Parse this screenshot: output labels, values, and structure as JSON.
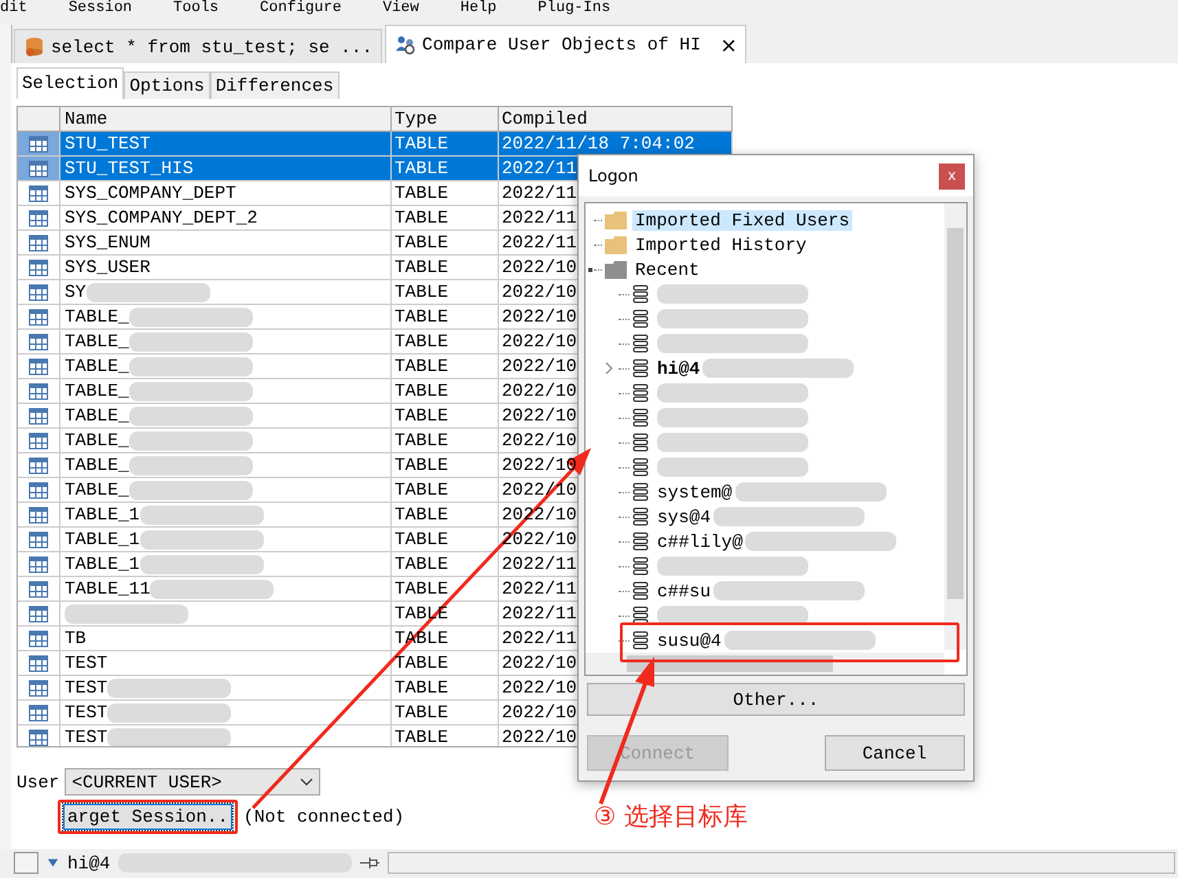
{
  "menu": [
    "dit",
    "Session",
    "Tools",
    "Configure",
    "View",
    "Help",
    "Plug-Ins"
  ],
  "tabs": [
    {
      "label": "select * from stu_test; se ...",
      "selected": false,
      "kind": "sql"
    },
    {
      "label": "Compare User Objects of HI",
      "selected": true,
      "kind": "compare",
      "close": "×"
    }
  ],
  "subtabs": [
    {
      "label": "Selection",
      "selected": true
    },
    {
      "label": "Options",
      "selected": false
    },
    {
      "label": "Differences",
      "selected": false
    }
  ],
  "table": {
    "columns": [
      "Name",
      "Type",
      "Compiled"
    ],
    "rows": [
      {
        "name": "STU_TEST",
        "type": "TABLE",
        "compiled": "2022/11/18 7:04:02",
        "selected": true,
        "blurred": false
      },
      {
        "name": "STU_TEST_HIS",
        "type": "TABLE",
        "compiled": "2022/11",
        "selected": true,
        "blurred": false
      },
      {
        "name": "SYS_COMPANY_DEPT",
        "type": "TABLE",
        "compiled": "2022/11",
        "selected": false,
        "blurred": false
      },
      {
        "name": "SYS_COMPANY_DEPT_2",
        "type": "TABLE",
        "compiled": "2022/11",
        "selected": false,
        "blurred": false
      },
      {
        "name": "SYS_ENUM",
        "type": "TABLE",
        "compiled": "2022/11",
        "selected": false,
        "blurred": false
      },
      {
        "name": "SYS_USER",
        "type": "TABLE",
        "compiled": "2022/10",
        "selected": false,
        "blurred": false
      },
      {
        "name": "SY",
        "type": "TABLE",
        "compiled": "2022/10",
        "selected": false,
        "blurred": true
      },
      {
        "name": "TABLE_",
        "type": "TABLE",
        "compiled": "2022/10",
        "selected": false,
        "blurred": true
      },
      {
        "name": "TABLE_",
        "type": "TABLE",
        "compiled": "2022/10",
        "selected": false,
        "blurred": true
      },
      {
        "name": "TABLE_",
        "type": "TABLE",
        "compiled": "2022/10",
        "selected": false,
        "blurred": true
      },
      {
        "name": "TABLE_",
        "type": "TABLE",
        "compiled": "2022/10",
        "selected": false,
        "blurred": true
      },
      {
        "name": "TABLE_",
        "type": "TABLE",
        "compiled": "2022/10",
        "selected": false,
        "blurred": true
      },
      {
        "name": "TABLE_",
        "type": "TABLE",
        "compiled": "2022/10",
        "selected": false,
        "blurred": true
      },
      {
        "name": "TABLE_",
        "type": "TABLE",
        "compiled": "2022/10",
        "selected": false,
        "blurred": true
      },
      {
        "name": "TABLE_",
        "type": "TABLE",
        "compiled": "2022/10",
        "selected": false,
        "blurred": true
      },
      {
        "name": "TABLE_1",
        "type": "TABLE",
        "compiled": "2022/10",
        "selected": false,
        "blurred": true
      },
      {
        "name": "TABLE_1",
        "type": "TABLE",
        "compiled": "2022/10",
        "selected": false,
        "blurred": true
      },
      {
        "name": "TABLE_1",
        "type": "TABLE",
        "compiled": "2022/11",
        "selected": false,
        "blurred": true
      },
      {
        "name": "TABLE_11",
        "type": "TABLE",
        "compiled": "2022/11",
        "selected": false,
        "blurred": true
      },
      {
        "type": "TABLE",
        "compiled": "2022/11",
        "selected": false,
        "blurred": true
      },
      {
        "name": "TB",
        "type": "TABLE",
        "compiled": "2022/11",
        "selected": false,
        "blurred": false
      },
      {
        "name": "TEST",
        "type": "TABLE",
        "compiled": "2022/10",
        "selected": false,
        "blurred": false
      },
      {
        "name": "TEST",
        "type": "TABLE",
        "compiled": "2022/10",
        "selected": false,
        "blurred": true
      },
      {
        "name": "TEST",
        "type": "TABLE",
        "compiled": "2022/10",
        "selected": false,
        "blurred": true
      },
      {
        "name": "TEST",
        "type": "TABLE",
        "compiled": "2022/10",
        "selected": false,
        "blurred": true
      }
    ]
  },
  "user": {
    "label": "User",
    "value": "<CURRENT USER>"
  },
  "target_session": {
    "button": "arget Session..",
    "status": "(Not connected)"
  },
  "status_bar": {
    "session": "hi@4"
  },
  "logon": {
    "title": "Logon",
    "close": "x",
    "tree": [
      {
        "label": "Imported Fixed Users",
        "kind": "folder",
        "selected": true,
        "expanded": false
      },
      {
        "label": "Imported History",
        "kind": "folder",
        "selected": false,
        "expanded": false
      },
      {
        "label": "Recent",
        "kind": "group",
        "selected": false,
        "expanded": true,
        "children": [
          {
            "blurred": true,
            "expandable": false
          },
          {
            "blurred": true,
            "expandable": false
          },
          {
            "blurred": true,
            "expandable": false
          },
          {
            "label": "hi@4",
            "blurred": true,
            "bold": true,
            "expandable": true
          },
          {
            "blurred": true,
            "expandable": false
          },
          {
            "blurred": true,
            "expandable": false
          },
          {
            "blurred": true,
            "expandable": false
          },
          {
            "blurred": true,
            "expandable": false
          },
          {
            "label": "system@",
            "blurred": true,
            "bold": false,
            "expandable": false
          },
          {
            "label": "sys@4",
            "blurred": true,
            "bold": false,
            "expandable": false
          },
          {
            "label": "c##lily@",
            "blurred": true,
            "bold": false,
            "expandable": false
          },
          {
            "blurred": true,
            "expandable": false
          },
          {
            "label": "c##su",
            "blurred": true,
            "bold": false,
            "expandable": false
          },
          {
            "blurred": true,
            "expandable": false
          },
          {
            "label": "susu@4",
            "blurred": true,
            "bold": false,
            "expandable": false
          }
        ]
      }
    ],
    "buttons": [
      {
        "label": "Other...",
        "kind": "wide",
        "disabled": false
      },
      {
        "label": "Connect",
        "kind": "left",
        "disabled": true
      },
      {
        "label": "Cancel",
        "kind": "right",
        "disabled": false
      }
    ]
  },
  "annotation": {
    "text": "③ 选择目标库"
  }
}
